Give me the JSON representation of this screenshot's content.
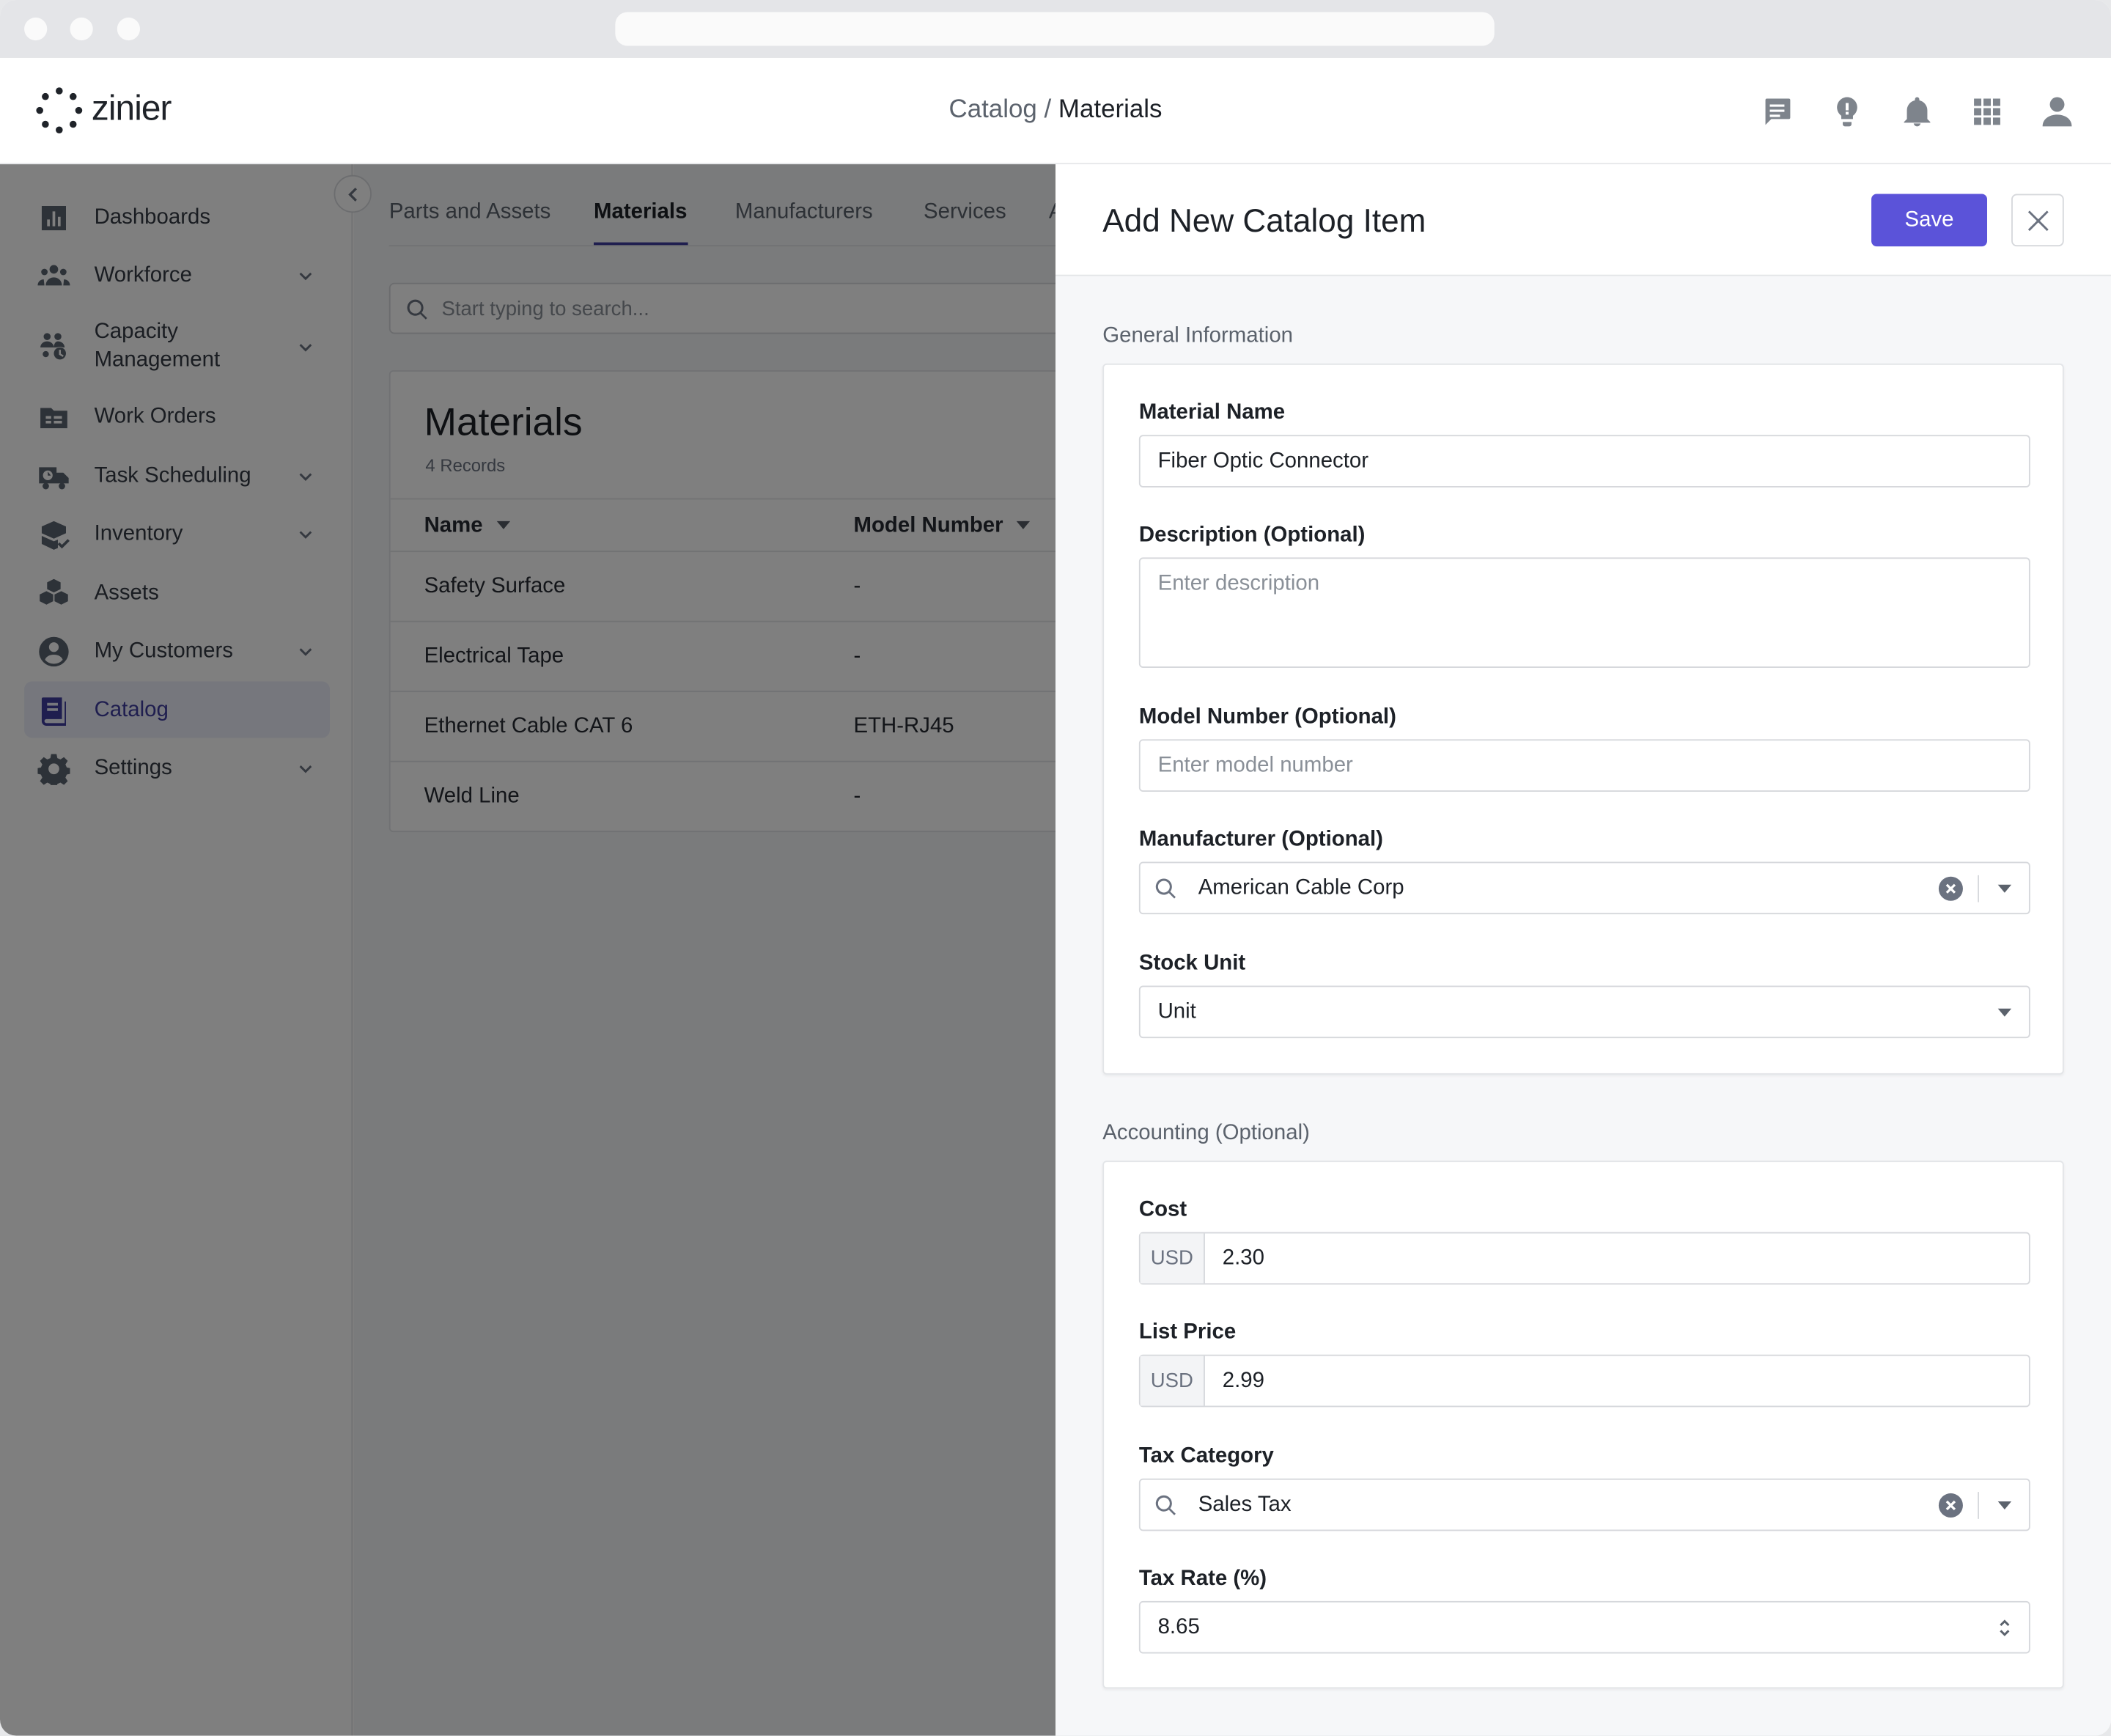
{
  "app": {
    "brand": "zinier",
    "breadcrumb": {
      "parent": "Catalog",
      "separator": " / ",
      "current": "Materials"
    }
  },
  "header_icons": [
    "chat-icon",
    "lightbulb-icon",
    "bell-icon",
    "apps-grid-icon",
    "user-icon"
  ],
  "sidebar": {
    "items": [
      {
        "label": "Dashboards",
        "icon": "dashboards-icon",
        "expandable": false
      },
      {
        "label": "Workforce",
        "icon": "workforce-icon",
        "expandable": true
      },
      {
        "label": "Capacity\nManagement",
        "icon": "capacity-icon",
        "expandable": true
      },
      {
        "label": "Work Orders",
        "icon": "work-orders-icon",
        "expandable": false
      },
      {
        "label": "Task Scheduling",
        "icon": "task-scheduling-icon",
        "expandable": true
      },
      {
        "label": "Inventory",
        "icon": "inventory-icon",
        "expandable": true
      },
      {
        "label": "Assets",
        "icon": "assets-icon",
        "expandable": false
      },
      {
        "label": "My Customers",
        "icon": "customers-icon",
        "expandable": true
      },
      {
        "label": "Catalog",
        "icon": "catalog-icon",
        "expandable": false,
        "active": true
      },
      {
        "label": "Settings",
        "icon": "settings-icon",
        "expandable": true
      }
    ]
  },
  "tabs": [
    "Parts and Assets",
    "Materials",
    "Manufacturers",
    "Services",
    "A"
  ],
  "active_tab": "Materials",
  "search": {
    "placeholder": "Start typing to search..."
  },
  "materials_table": {
    "title": "Materials",
    "record_count": "4 Records",
    "columns": [
      "Name",
      "Model Number"
    ],
    "rows": [
      [
        "Safety Surface",
        "-"
      ],
      [
        "Electrical Tape",
        "-"
      ],
      [
        "Ethernet Cable CAT 6",
        "ETH-RJ45"
      ],
      [
        "Weld Line",
        "-"
      ]
    ]
  },
  "drawer": {
    "title": "Add New Catalog Item",
    "save_label": "Save",
    "general": {
      "section_title": "General Information",
      "material_name_label": "Material Name",
      "material_name_value": "Fiber Optic Connector",
      "description_label": "Description (Optional)",
      "description_placeholder": "Enter description",
      "model_number_label": "Model Number (Optional)",
      "model_number_placeholder": "Enter model number",
      "manufacturer_label": "Manufacturer (Optional)",
      "manufacturer_value": "American Cable Corp",
      "stock_unit_label": "Stock Unit",
      "stock_unit_value": "Unit"
    },
    "accounting": {
      "section_title": "Accounting (Optional)",
      "cost_label": "Cost",
      "cost_currency": "USD",
      "cost_value": "2.30",
      "list_price_label": "List Price",
      "list_price_currency": "USD",
      "list_price_value": "2.99",
      "tax_category_label": "Tax Category",
      "tax_category_value": "Sales Tax",
      "tax_rate_label": "Tax Rate (%)",
      "tax_rate_value": "8.65"
    }
  },
  "colors": {
    "accent": "#5b53d9",
    "active_nav": "#3e3c9e",
    "overlay": "rgba(0,0,0,0.5)"
  }
}
